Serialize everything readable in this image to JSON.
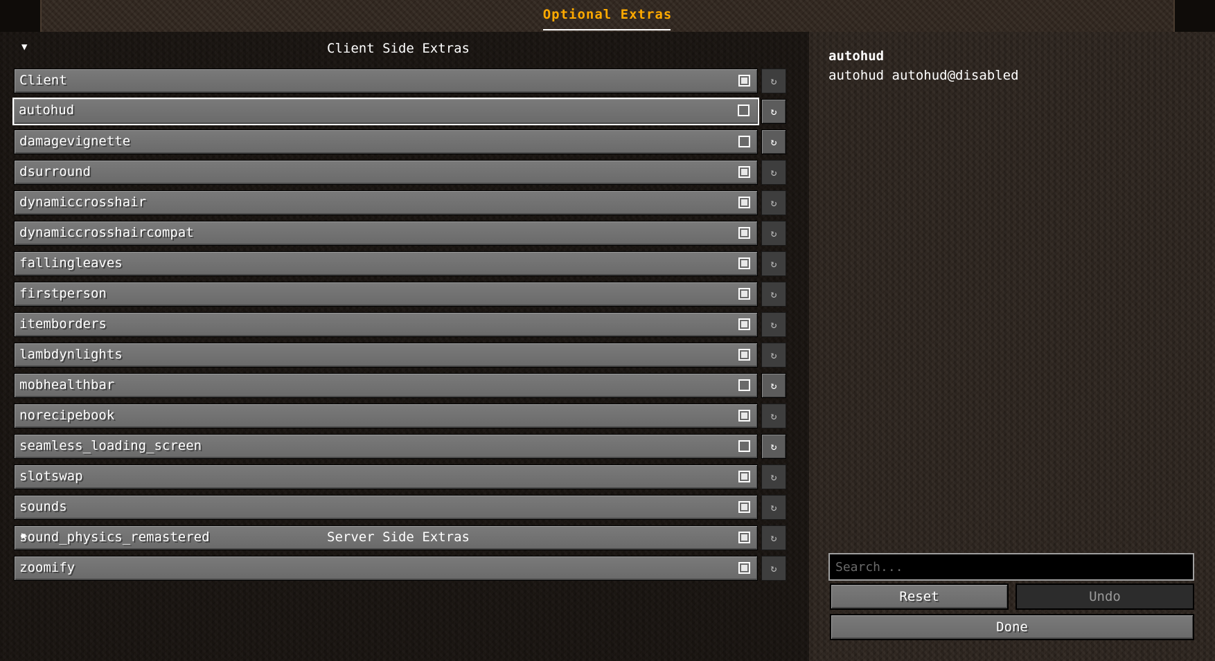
{
  "header": {
    "title": "Optional Extras"
  },
  "sections": {
    "client": {
      "label": "Client Side Extras",
      "arrow": "▼",
      "expanded": true
    },
    "server": {
      "label": "Server Side Extras",
      "arrow": "▶",
      "expanded": false
    }
  },
  "entries": [
    {
      "name": "Client",
      "checked": true,
      "reset_active": false
    },
    {
      "name": "autohud",
      "checked": false,
      "reset_active": true,
      "selected": true
    },
    {
      "name": "damagevignette",
      "checked": false,
      "reset_active": true
    },
    {
      "name": "dsurround",
      "checked": true,
      "reset_active": false
    },
    {
      "name": "dynamiccrosshair",
      "checked": true,
      "reset_active": false
    },
    {
      "name": "dynamiccrosshaircompat",
      "checked": true,
      "reset_active": false
    },
    {
      "name": "fallingleaves",
      "checked": true,
      "reset_active": false
    },
    {
      "name": "firstperson",
      "checked": true,
      "reset_active": false
    },
    {
      "name": "itemborders",
      "checked": true,
      "reset_active": false
    },
    {
      "name": "lambdynlights",
      "checked": true,
      "reset_active": false
    },
    {
      "name": "mobhealthbar",
      "checked": false,
      "reset_active": true
    },
    {
      "name": "norecipebook",
      "checked": true,
      "reset_active": false
    },
    {
      "name": "seamless_loading_screen",
      "checked": false,
      "reset_active": true
    },
    {
      "name": "slotswap",
      "checked": true,
      "reset_active": false
    },
    {
      "name": "sounds",
      "checked": true,
      "reset_active": false
    },
    {
      "name": "sound_physics_remastered",
      "checked": true,
      "reset_active": false
    },
    {
      "name": "zoomify",
      "checked": true,
      "reset_active": false
    }
  ],
  "reset_icon": "↻",
  "detail": {
    "title": "autohud",
    "description": "autohud autohud@disabled"
  },
  "search": {
    "placeholder": "Search...",
    "value": ""
  },
  "buttons": {
    "reset_label": "Reset",
    "undo_label": "Undo",
    "done_label": "Done"
  }
}
